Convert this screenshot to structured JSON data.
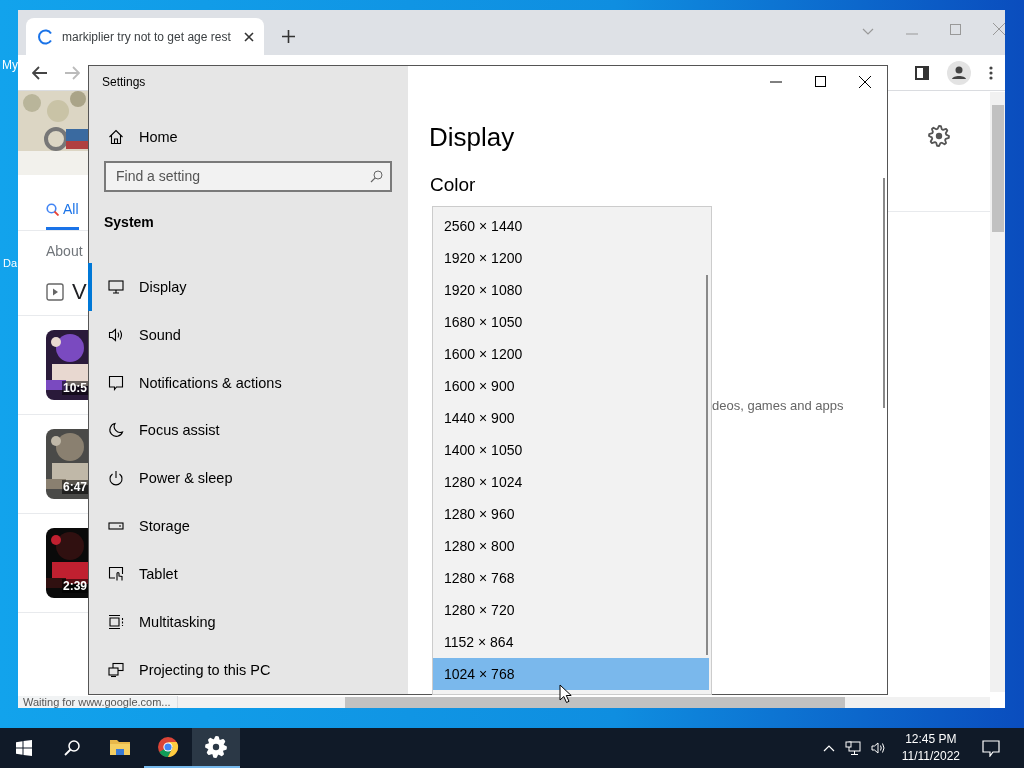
{
  "desktop": {
    "icon_labels": [
      "My",
      "Da"
    ]
  },
  "browser": {
    "tab": {
      "title": "markiplier try not to get age rest",
      "loading": true
    },
    "page": {
      "search_tabs": [
        {
          "label": "All",
          "selected": true
        }
      ],
      "about_text": "About",
      "section_heading": "V",
      "videos": [
        {
          "duration": "10:5"
        },
        {
          "duration": "6:47"
        },
        {
          "duration": "2:39"
        }
      ]
    },
    "status": "Waiting for www.google.com..."
  },
  "settings": {
    "title": "Settings",
    "home": "Home",
    "search_placeholder": "Find a setting",
    "group": "System",
    "nav": [
      {
        "kind": "display",
        "label": "Display",
        "selected": true
      },
      {
        "kind": "sound",
        "label": "Sound",
        "selected": false
      },
      {
        "kind": "notifications",
        "label": "Notifications & actions",
        "selected": false
      },
      {
        "kind": "focus",
        "label": "Focus assist",
        "selected": false
      },
      {
        "kind": "power",
        "label": "Power & sleep",
        "selected": false
      },
      {
        "kind": "storage",
        "label": "Storage",
        "selected": false
      },
      {
        "kind": "tablet",
        "label": "Tablet",
        "selected": false
      },
      {
        "kind": "multitasking",
        "label": "Multitasking",
        "selected": false
      },
      {
        "kind": "projecting",
        "label": "Projecting to this PC",
        "selected": false
      }
    ],
    "heading": "Display",
    "section": "Color",
    "fragment": "deos, games and apps",
    "resolution_options": [
      {
        "label": "2560 × 1440",
        "selected": false
      },
      {
        "label": "1920 × 1200",
        "selected": false
      },
      {
        "label": "1920 × 1080",
        "selected": false
      },
      {
        "label": "1680 × 1050",
        "selected": false
      },
      {
        "label": "1600 × 1200",
        "selected": false
      },
      {
        "label": "1600 × 900",
        "selected": false
      },
      {
        "label": "1440 × 900",
        "selected": false
      },
      {
        "label": "1400 × 1050",
        "selected": false
      },
      {
        "label": "1280 × 1024",
        "selected": false
      },
      {
        "label": "1280 × 960",
        "selected": false
      },
      {
        "label": "1280 × 800",
        "selected": false
      },
      {
        "label": "1280 × 768",
        "selected": false
      },
      {
        "label": "1280 × 720",
        "selected": false
      },
      {
        "label": "1152 × 864",
        "selected": false
      },
      {
        "label": "1024 × 768",
        "selected": true
      }
    ]
  },
  "taskbar": {
    "apps": [
      {
        "kind": "explorer",
        "running": false,
        "focused": false
      },
      {
        "kind": "chrome",
        "running": true,
        "focused": false
      },
      {
        "kind": "settings",
        "running": true,
        "focused": true
      }
    ],
    "clock": {
      "time": "12:45 PM",
      "date": "11/11/2022"
    }
  }
}
